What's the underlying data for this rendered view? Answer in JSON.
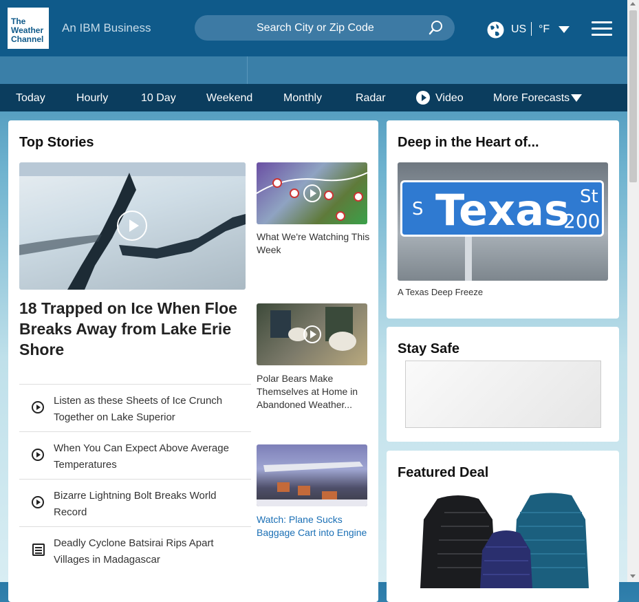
{
  "header": {
    "logo_line1": "The",
    "logo_line2": "Weather",
    "logo_line3": "Channel",
    "ibm_label": "An IBM Business",
    "search_placeholder": "Search City or Zip Code",
    "country": "US",
    "unit": "°F"
  },
  "nav": {
    "items": [
      "Today",
      "Hourly",
      "10 Day",
      "Weekend",
      "Monthly",
      "Radar",
      "Video",
      "More Forecasts"
    ]
  },
  "top_stories": {
    "title": "Top Stories",
    "headline": "18 Trapped on Ice When Floe Breaks Away from Lake Erie Shore",
    "list": [
      {
        "text": "Listen as these Sheets of Ice Crunch Together on Lake Superior",
        "icon": "play-circle-icon"
      },
      {
        "text": "When You Can Expect Above Average Temperatures",
        "icon": "play-circle-icon"
      },
      {
        "text": "Bizarre Lightning Bolt Breaks World Record",
        "icon": "play-circle-icon"
      },
      {
        "text": "Deadly Cyclone Batsirai Rips Apart Villages in Madagascar",
        "icon": "article-icon"
      }
    ],
    "side": [
      {
        "caption": "What We're Watching This Week"
      },
      {
        "caption": "Polar Bears Make Themselves at Home in Abandoned Weather..."
      },
      {
        "caption": "Watch: Plane Sucks Baggage Cart into Engine"
      }
    ]
  },
  "deep_heart": {
    "title": "Deep in the Heart of...",
    "sign_text": "Texas",
    "sign_prefix": "S",
    "sign_suffix": "St",
    "sign_number": "200",
    "caption": "A Texas Deep Freeze"
  },
  "stay_safe": {
    "title": "Stay Safe"
  },
  "featured_deal": {
    "title": "Featured Deal"
  },
  "colors": {
    "header": "#0f5a8a",
    "nav": "#0b3d5e",
    "link": "#1a6fb5"
  }
}
